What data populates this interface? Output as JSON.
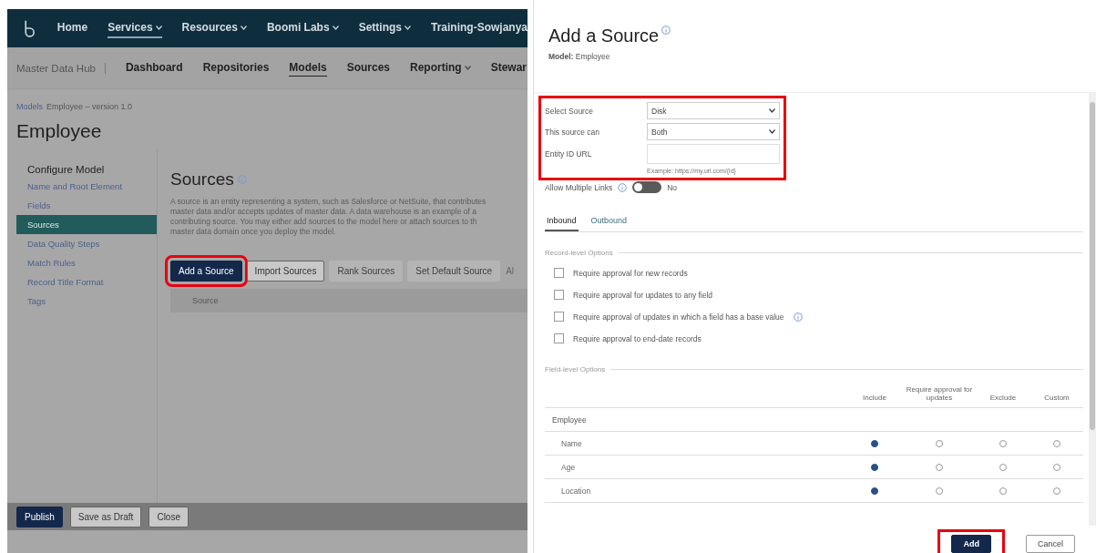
{
  "background_page": {
    "nav": [
      {
        "label": "Home",
        "dropdown": false,
        "selected": false
      },
      {
        "label": "Services",
        "dropdown": true,
        "selected": true
      },
      {
        "label": "Resources",
        "dropdown": true,
        "selected": false
      },
      {
        "label": "Boomi Labs",
        "dropdown": true,
        "selected": false
      },
      {
        "label": "Settings",
        "dropdown": true,
        "selected": false
      },
      {
        "label": "Training-Sowjanya",
        "dropdown": false,
        "selected": false
      }
    ],
    "subnav": {
      "app": "Master Data Hub",
      "items": [
        {
          "label": "Dashboard",
          "dropdown": false,
          "selected": false
        },
        {
          "label": "Repositories",
          "dropdown": false,
          "selected": false
        },
        {
          "label": "Models",
          "dropdown": false,
          "selected": true
        },
        {
          "label": "Sources",
          "dropdown": false,
          "selected": false
        },
        {
          "label": "Reporting",
          "dropdown": true,
          "selected": false
        },
        {
          "label": "Stewar",
          "dropdown": false,
          "selected": false
        }
      ]
    },
    "breadcrumb": {
      "link": "Models",
      "current": "Employee – version 1.0"
    },
    "title": "Employee",
    "sidebar": {
      "heading": "Configure Model",
      "items": [
        {
          "label": "Name and Root Element",
          "selected": false
        },
        {
          "label": "Fields",
          "selected": false
        },
        {
          "label": "Sources",
          "selected": true
        },
        {
          "label": "Data Quality Steps",
          "selected": false
        },
        {
          "label": "Match Rules",
          "selected": false
        },
        {
          "label": "Record Title Format",
          "selected": false
        },
        {
          "label": "Tags",
          "selected": false
        }
      ]
    },
    "section_title": "Sources",
    "description": [
      "A source is an entity representing a system, such as Salesforce or NetSuite, that contributes",
      "master data and/or accepts updates of master data. A data warehouse is an example of a",
      "contributing source. You may either add sources to the model here or attach sources to th",
      "master data domain once you deploy the model."
    ],
    "actions": [
      {
        "label": "Add a Source",
        "kind": "primary",
        "highlighted": true
      },
      {
        "label": "Import Sources",
        "kind": "outline",
        "highlighted": false
      },
      {
        "label": "Rank Sources",
        "kind": "disabled",
        "highlighted": false
      },
      {
        "label": "Set Default Source",
        "kind": "disabled",
        "highlighted": false
      },
      {
        "label": "Al",
        "kind": "link",
        "highlighted": false
      }
    ],
    "table": {
      "columns": [
        "Source"
      ]
    },
    "footer_buttons": [
      {
        "label": "Publish",
        "kind": "primary"
      },
      {
        "label": "Save as Draft",
        "kind": "outline"
      },
      {
        "label": "Close",
        "kind": "outline"
      }
    ]
  },
  "dialog": {
    "title": "Add a Source",
    "model_line": "**Model:** Employee",
    "form": {
      "highlighted": true,
      "fields": [
        {
          "label": "Select Source",
          "kind": "select",
          "value": "Disk"
        },
        {
          "label": "This source can",
          "kind": "select",
          "value": "Both"
        },
        {
          "label": "Entity ID URL",
          "kind": "text",
          "hint": "Example: https://my.url.com/{id}"
        }
      ]
    },
    "multiple_links": {
      "label": "Allow Multiple Links",
      "on": false,
      "state_text": "No"
    },
    "tabs": [
      {
        "label": "Inbound",
        "selected": true
      },
      {
        "label": "Outbound",
        "selected": false
      }
    ],
    "record_options": {
      "legend": "Record-level Options",
      "items": [
        {
          "label": "Require approval for new records",
          "checked": false,
          "info": false
        },
        {
          "label": "Require approval for updates to any field",
          "checked": false,
          "info": false
        },
        {
          "label": "Require approval of updates in which a field has a base value",
          "checked": false,
          "info": true
        },
        {
          "label": "Require approval to end-date records",
          "checked": false,
          "info": false
        }
      ]
    },
    "field_options": {
      "legend": "Field-level Options",
      "columns": [
        "Include",
        "Require approval for updates",
        "Exclude",
        "Custom"
      ],
      "group": "Employee",
      "rows": [
        {
          "name": "Name",
          "options": [
            {
              "selected": true
            },
            {
              "selected": false
            },
            {
              "selected": false
            },
            {
              "selected": false
            }
          ]
        },
        {
          "name": "Age",
          "options": [
            {
              "selected": true
            },
            {
              "selected": false
            },
            {
              "selected": false
            },
            {
              "selected": false
            }
          ]
        },
        {
          "name": "Location",
          "options": [
            {
              "selected": true
            },
            {
              "selected": false
            },
            {
              "selected": false
            },
            {
              "selected": false
            }
          ]
        }
      ]
    },
    "buttons": [
      {
        "label": "Add",
        "kind": "primary",
        "highlighted": true
      },
      {
        "label": "Cancel",
        "kind": "outline",
        "highlighted": false
      }
    ]
  }
}
